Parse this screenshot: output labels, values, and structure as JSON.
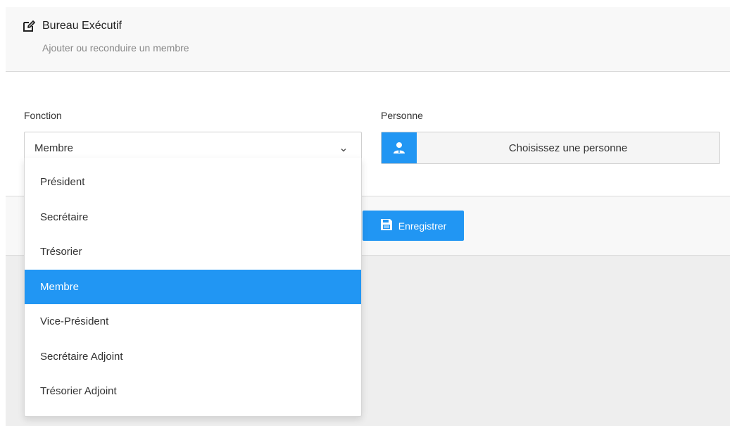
{
  "header": {
    "title": "Bureau Exécutif",
    "subtitle": "Ajouter ou reconduire un membre",
    "icon": "edit-icon"
  },
  "form": {
    "function_label": "Fonction",
    "function_value": "Membre",
    "person_label": "Personne",
    "person_placeholder": "Choisissez une personne",
    "person_icon": "user-icon"
  },
  "footer": {
    "save_label": "Enregistrer",
    "save_icon": "save-icon"
  },
  "dropdown": {
    "options": [
      {
        "label": "Président"
      },
      {
        "label": "Secrétaire"
      },
      {
        "label": "Trésorier"
      },
      {
        "label": "Membre"
      },
      {
        "label": "Vice-Président"
      },
      {
        "label": "Secrétaire Adjoint"
      },
      {
        "label": "Trésorier Adjoint"
      }
    ],
    "selected": "Membre"
  },
  "colors": {
    "accent": "#2196f3"
  }
}
